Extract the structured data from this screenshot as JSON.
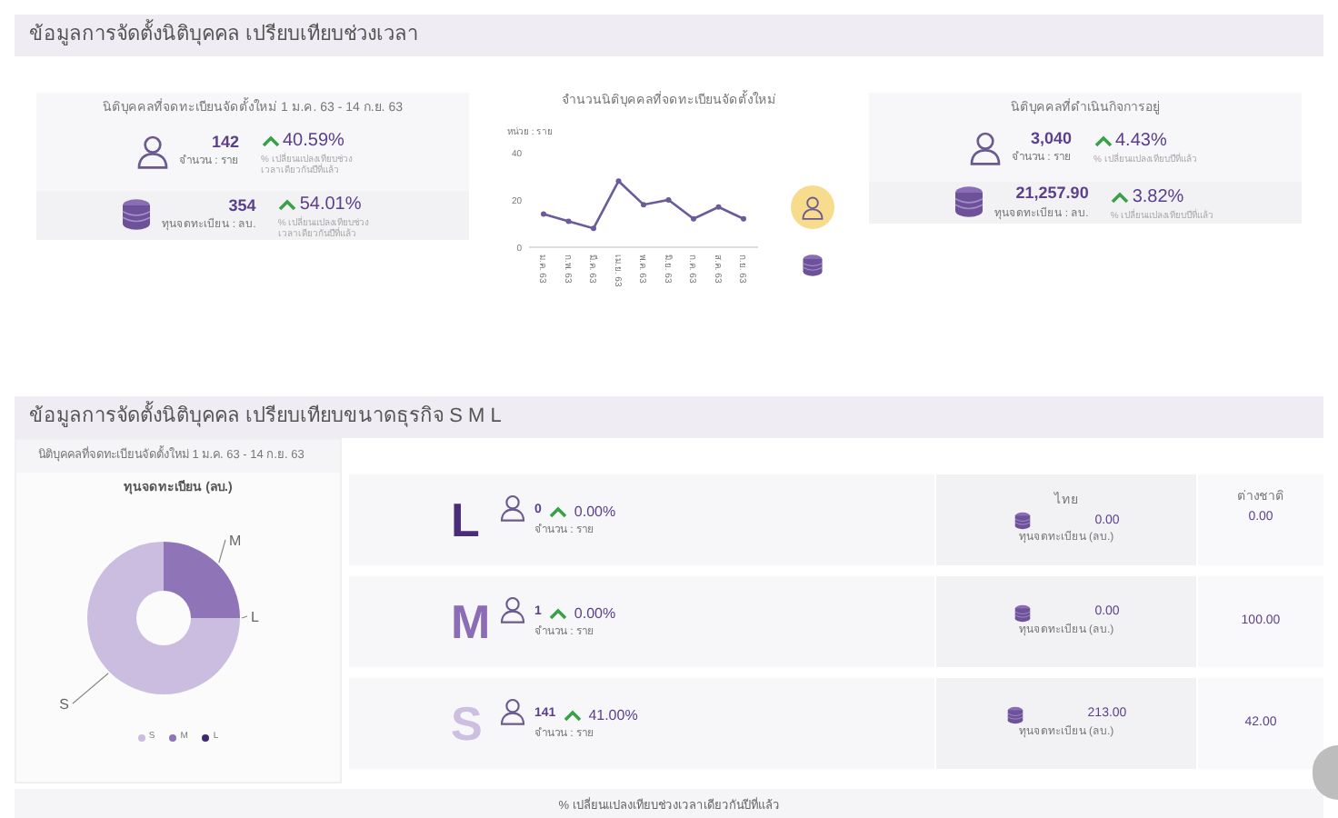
{
  "time_section": {
    "title": "ข้อมูลการจัดตั้งนิติบุคคล เปรียบเทียบช่วงเวลา",
    "new_card": {
      "title": "นิติบุคคลที่จดทะเบียนจัดตั้งใหม่ 1 ม.ค. 63 - 14 ก.ย. 63",
      "stats": [
        {
          "kind": "person",
          "value": "142",
          "unit": "จำนวน : ราย",
          "change": "40.59%",
          "note": "% เปลี่ยนแปลงเทียบช่วงเวลาเดียวกันปีที่แล้ว"
        },
        {
          "kind": "coins",
          "value": "354",
          "unit": "ทุนจดทะเบียน : ลบ.",
          "change": "54.01%",
          "note": "% เปลี่ยนแปลงเทียบช่วงเวลาเดียวกันปีที่แล้ว"
        }
      ]
    },
    "trend": {
      "title": "จำนวนนิติบุคคลที่จดทะเบียนจัดตั้งใหม่",
      "toggles": [
        {
          "kind": "person",
          "selected": true
        },
        {
          "kind": "coins",
          "selected": false
        }
      ],
      "chart_data": {
        "type": "line",
        "ylabel": "หน่วย : ราย",
        "categories": [
          "ม.ค. 63",
          "ก.พ. 63",
          "มี.ค. 63",
          "เม.ย. 63",
          "พ.ค. 63",
          "มิ.ย. 63",
          "ก.ค. 63",
          "ส.ค. 63",
          "ก.ย. 63"
        ],
        "series": [
          {
            "color": "#6b5b9a",
            "marker": "circle",
            "values": [
              14,
              11,
              8,
              28,
              18,
              20,
              12,
              17,
              12
            ]
          }
        ],
        "ylim": [
          0,
          40
        ],
        "yticks": [
          0,
          20,
          40
        ]
      }
    },
    "active_card": {
      "title": "นิติบุคคลที่ดำเนินกิจการอยู่",
      "stats": [
        {
          "kind": "person",
          "value": "3,040",
          "unit": "จำนวน : ราย",
          "change": "4.43%",
          "note": "% เปลี่ยนแปลงเทียบปีที่แล้ว"
        },
        {
          "kind": "coins",
          "value": "21,257.90",
          "unit": "ทุนจดทะเบียน : ลบ.",
          "change": "3.82%",
          "note": "% เปลี่ยนแปลงเทียบปีที่แล้ว"
        }
      ]
    }
  },
  "size_section": {
    "title": "ข้อมูลการจัดตั้งนิติบุคคล เปรียบเทียบขนาดธุรกิจ S M L",
    "period": "นิติบุคคลที่จดทะเบียนจัดตั้งใหม่ 1 ม.ค. 63 - 14 ก.ย. 63",
    "chart_data": {
      "type": "donut",
      "title": "ทุนจดทะเบียน (ลบ.)",
      "categories": [
        "S",
        "M",
        "L"
      ],
      "series": [
        {
          "values": [
            75,
            25,
            0
          ]
        }
      ],
      "colors": [
        "#cbbde0",
        "#8f74b8",
        "#3f2a6b"
      ],
      "legend": "bottom"
    },
    "columns": [
      "ไทย",
      "ต่างชาติ"
    ],
    "rows": [
      {
        "size": "L",
        "color": "#4a2d7a",
        "count": "0",
        "unit": "จำนวน : ราย",
        "change": "0.00%",
        "thai": "0.00",
        "thai_unit": "ทุนจดทะเบียน (ลบ.)",
        "foreign": "0.00"
      },
      {
        "size": "M",
        "color": "#8a6db5",
        "count": "1",
        "unit": "จำนวน : ราย",
        "change": "0.00%",
        "thai": "0.00",
        "thai_unit": "ทุนจดทะเบียน (ลบ.)",
        "foreign": "100.00"
      },
      {
        "size": "S",
        "color": "#cdbfe0",
        "count": "141",
        "unit": "จำนวน : ราย",
        "change": "41.00%",
        "thai": "213.00",
        "thai_unit": "ทุนจดทะเบียน (ลบ.)",
        "foreign": "42.00"
      }
    ]
  },
  "footer": "% เปลี่ยนแปลงเทียบช่วงเวลาเดียวกันปีที่แล้ว"
}
